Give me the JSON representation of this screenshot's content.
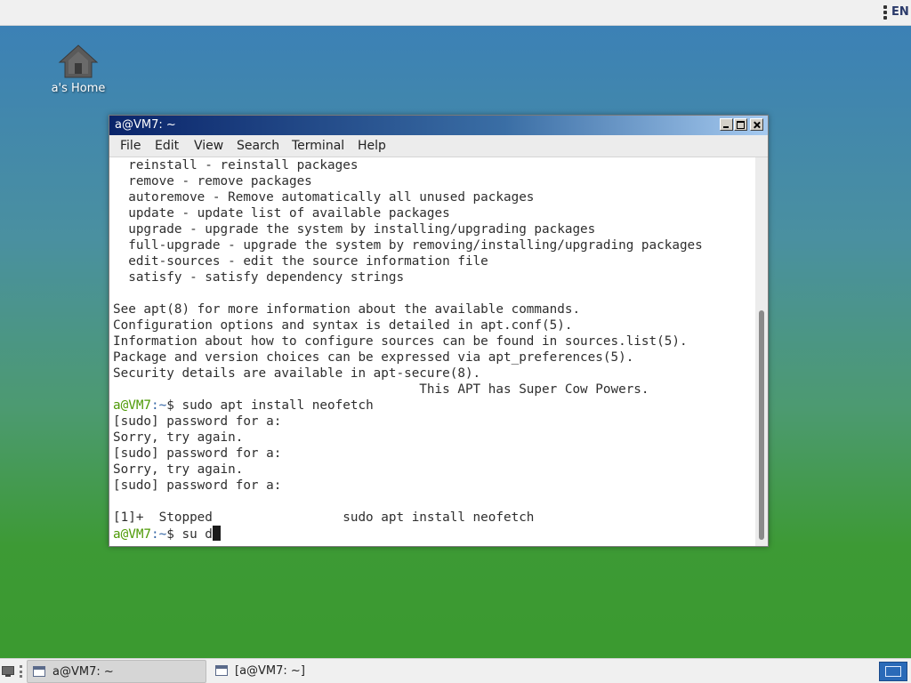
{
  "top_panel": {
    "language": "EN"
  },
  "desktop": {
    "home_icon_label": "a's Home"
  },
  "window": {
    "title": "a@VM7: ~",
    "menu": [
      "File",
      "Edit",
      "View",
      "Search",
      "Terminal",
      "Help"
    ]
  },
  "terminal": {
    "lines": [
      "  reinstall - reinstall packages",
      "  remove - remove packages",
      "  autoremove - Remove automatically all unused packages",
      "  update - update list of available packages",
      "  upgrade - upgrade the system by installing/upgrading packages",
      "  full-upgrade - upgrade the system by removing/installing/upgrading packages",
      "  edit-sources - edit the source information file",
      "  satisfy - satisfy dependency strings",
      "",
      "See apt(8) for more information about the available commands.",
      "Configuration options and syntax is detailed in apt.conf(5).",
      "Information about how to configure sources can be found in sources.list(5).",
      "Package and version choices can be expressed via apt_preferences(5).",
      "Security details are available in apt-secure(8).",
      "                                        This APT has Super Cow Powers.",
      "",
      "[sudo] password for a:",
      "Sorry, try again.",
      "[sudo] password for a:",
      "Sorry, try again.",
      "[sudo] password for a:",
      "",
      "[1]+  Stopped                 sudo apt install neofetch",
      ""
    ],
    "prompt_user": "a@VM7",
    "prompt_path": ":~",
    "prompt_symbol": "$ ",
    "command_1": "sudo apt install neofetch",
    "current_input": "su d"
  },
  "taskbar": {
    "tasks": [
      {
        "label": "a@VM7: ~"
      },
      {
        "label": "[a@VM7: ~]"
      }
    ]
  },
  "colors": {
    "prompt_user": "#4e9a06",
    "prompt_path": "#3465a4",
    "titlebar_start": "#0a246a",
    "titlebar_end": "#a6caf0"
  },
  "icons": {
    "home": "home-icon",
    "minimize": "minimize-icon",
    "maximize": "maximize-icon",
    "close": "close-icon",
    "menu_dots": "menu-dots-icon",
    "show_desktop": "show-desktop-icon",
    "window": "window-icon",
    "workspace": "workspace-switcher-icon"
  }
}
